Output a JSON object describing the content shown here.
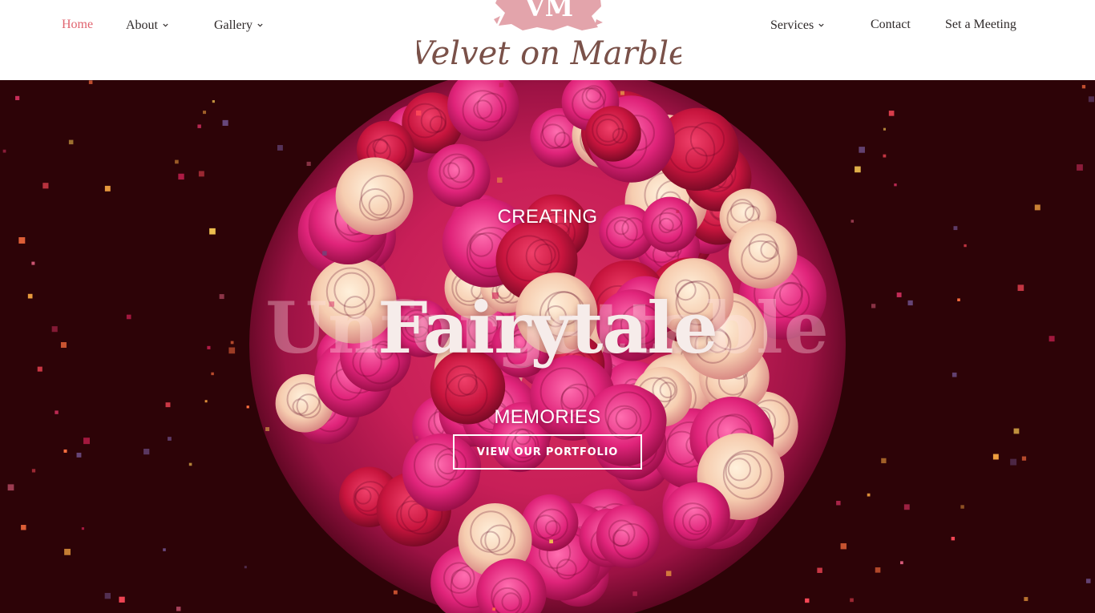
{
  "nav": {
    "left": [
      {
        "label": "Home",
        "active": true,
        "dropdown": false
      },
      {
        "label": "About",
        "active": false,
        "dropdown": true
      },
      {
        "label": "Gallery",
        "active": false,
        "dropdown": true
      }
    ],
    "right": [
      {
        "label": "Services",
        "active": false,
        "dropdown": true
      },
      {
        "label": "Contact",
        "active": false,
        "dropdown": false
      },
      {
        "label": "Set a Meeting",
        "active": false,
        "dropdown": false
      }
    ]
  },
  "logo": {
    "monogram": "VM",
    "wordmark": "Velvet on Marble"
  },
  "hero": {
    "kicker": "CREATING",
    "title": "Fairytale",
    "ghost_title": "Unforgettable",
    "subtitle": "MEMORIES",
    "cta_label": "VIEW OUR PORTFOLIO"
  },
  "colors": {
    "accent": "#e0636e",
    "hero_background": "#2d0307",
    "logo_brown": "#7a5149",
    "logo_pink": "#e3a4ab"
  }
}
